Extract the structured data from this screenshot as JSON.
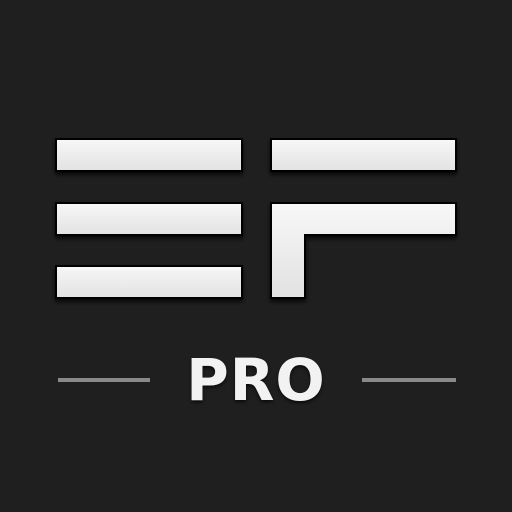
{
  "app_icon": {
    "badge_text": "PRO",
    "colors": {
      "background": "#1f1f1f",
      "mark": "#efefef",
      "rule": "#8a8a8a"
    },
    "mark_icon": "ef-logo-icon"
  }
}
